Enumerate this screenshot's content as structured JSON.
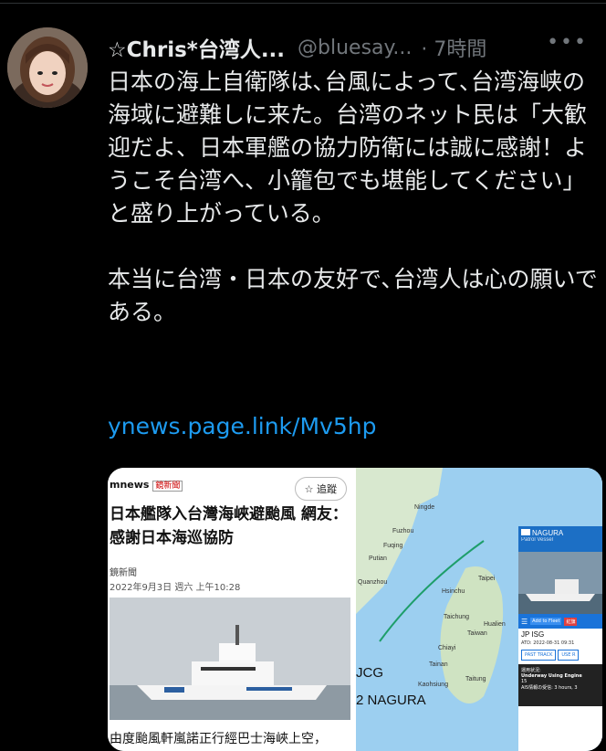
{
  "tweet": {
    "display_name": "☆Chris*台湾人...",
    "handle": "@bluesay...",
    "time": "· 7時間",
    "more_icon": "more-horizontal-icon",
    "text_p1": "日本の海上自衛隊は､台風によって､台湾海峡の海域に避難しに来た。台湾のネット民は「大歓迎だよ、日本軍艦の協力防衛には誠に感謝！ようこそ台湾へ、小籠包でも堪能してください」と盛り上がっている。",
    "text_p2": "本当に台湾・日本の友好で､台湾人は心の願いである。",
    "link": "ynews.page.link/Mv5hp",
    "colors": {
      "background": "#000000",
      "text": "#e7e9ea",
      "secondary": "#71767b",
      "link": "#1d9bf0"
    }
  },
  "news_card": {
    "logo": "mnews",
    "logo_tag": "鏡新聞",
    "follow_label": "☆ 追蹤",
    "headline": "日本艦隊入台灣海峽避颱風 網友：感謝日本海巡協防",
    "source": "鏡新聞",
    "date": "2022年9月3日 週六 上午10:28",
    "caption": "由度颱風軒嵐諾正行經巴士海峽上空，"
  },
  "map": {
    "labels_large": [
      "JCG",
      "2 NAGURA"
    ],
    "labels_small": [
      "Ningde",
      "Fuzhou",
      "Fuqing",
      "Putian",
      "Quanzhou",
      "Hsinchu",
      "Taipei",
      "Taichung",
      "Taiwan",
      "Chiayi",
      "Hualien",
      "Tainan",
      "Kaohsiung",
      "Taitung"
    ],
    "panel": {
      "flag": "JP",
      "title": "NAGURA",
      "subtitle": "Patrol Vessel",
      "add_btn": "Add to Fleet",
      "red_btn": "紅旗",
      "route": "JP ISG",
      "atd": "ATD: 2022-08-31 09:31",
      "past_track": "PAST TRACK",
      "use_btn": "USE R",
      "status_label": "運用状況:",
      "status_value": "Underway Using Engine",
      "speed": "15",
      "extra": "AIS情報の受信: 3 hours, 3"
    }
  }
}
